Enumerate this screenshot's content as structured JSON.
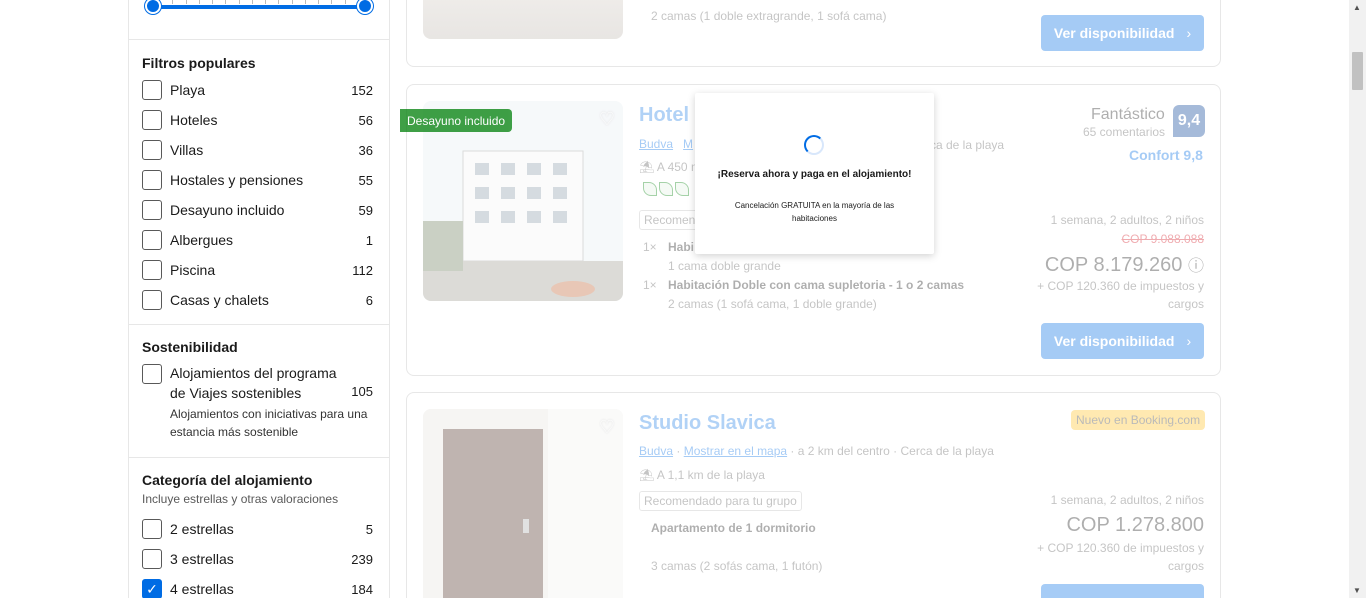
{
  "sidebar": {
    "popular": {
      "title": "Filtros populares",
      "items": [
        {
          "label": "Playa",
          "count": "152"
        },
        {
          "label": "Hoteles",
          "count": "56"
        },
        {
          "label": "Villas",
          "count": "36"
        },
        {
          "label": "Hostales y pensiones",
          "count": "55"
        },
        {
          "label": "Desayuno incluido",
          "count": "59"
        },
        {
          "label": "Albergues",
          "count": "1"
        },
        {
          "label": "Piscina",
          "count": "112"
        },
        {
          "label": "Casas y chalets",
          "count": "6"
        }
      ]
    },
    "sustainability": {
      "title": "Sostenibilidad",
      "label": "Alojamientos del programa de Viajes sostenibles",
      "count": "105",
      "desc": "Alojamientos con iniciativas para una estancia más sostenible"
    },
    "category": {
      "title": "Categoría del alojamiento",
      "subtitle": "Incluye estrellas y otras valoraciones",
      "items": [
        {
          "label": "2 estrellas",
          "count": "5",
          "checked": false
        },
        {
          "label": "3 estrellas",
          "count": "239",
          "checked": false
        },
        {
          "label": "4 estrellas",
          "count": "184",
          "checked": true
        }
      ]
    }
  },
  "card0": {
    "rooms": "2 camas (1 doble extragrande, 1 sofá cama)",
    "button": "Ver disponibilidad"
  },
  "card1": {
    "badge": "Desayuno incluido",
    "title": "Hotel",
    "town": "Budva",
    "map_partial": "M",
    "near_beach_partial": "rca de la playa",
    "distance_partial": "A 450 m",
    "reco_partial": "Recomenda",
    "room1_qty": "1×",
    "room1_name_partial": "Habi",
    "room1_beds": "1 cama doble grande",
    "room2_qty": "1×",
    "room2_name": "Habitación Doble con cama supletoria - 1 o 2 camas",
    "room2_beds": "2 camas (1 sofá cama, 1 doble grande)",
    "score_word": "Fantástico",
    "reviews": "65 comentarios",
    "score": "9,4",
    "comfort": "Confort 9,8",
    "stay": "1 semana, 2 adultos, 2 niños",
    "old_price": "COP 9.088.088",
    "price": "COP 8.179.260",
    "taxes": "+ COP 120.360 de impuestos y cargos",
    "button": "Ver disponibilidad"
  },
  "card2": {
    "title": "Studio Slavica",
    "new_badge": "Nuevo en Booking.com",
    "town": "Budva",
    "map": "Mostrar en el mapa",
    "center": "a 2 km del centro",
    "beach": "Cerca de la playa",
    "distance": "A 1,1 km de la playa",
    "reco": "Recomendado para tu grupo",
    "room": "Apartamento de 1 dormitorio",
    "beds": "3 camas (2 sofás cama, 1 futón)",
    "stay": "1 semana, 2 adultos, 2 niños",
    "price": "COP 1.278.800",
    "taxes": "+ COP 120.360 de impuestos y cargos"
  },
  "popup": {
    "title": "¡Reserva ahora y paga en el alojamiento!",
    "subtitle": "Cancelación GRATUITA en la mayoría de las habitaciones"
  },
  "icons": {
    "heart": "♡",
    "chevron": "›",
    "check": "✓",
    "info": "ⓘ",
    "beach": "⛱",
    "scroll_up": "▲",
    "scroll_down": "▼"
  },
  "colors": {
    "accent": "#006ce4",
    "score": "#003b95",
    "breakfast": "#008009",
    "old_price": "#d4111e"
  }
}
